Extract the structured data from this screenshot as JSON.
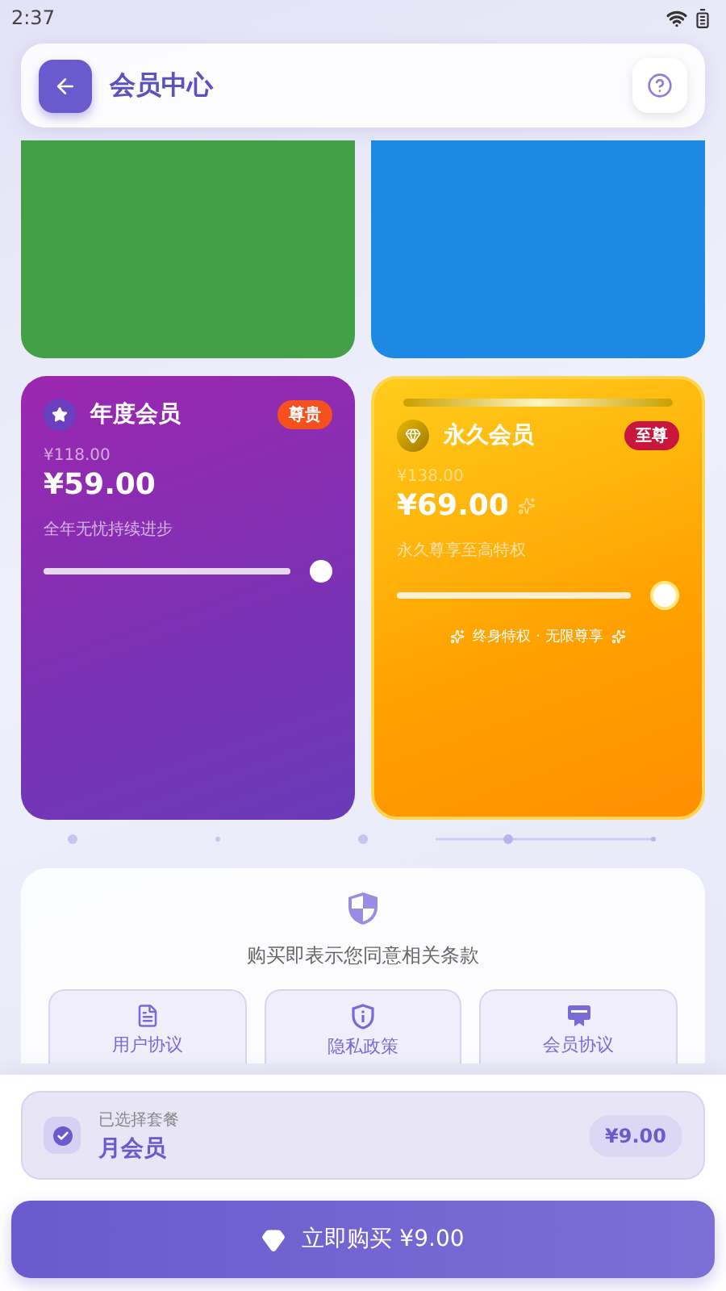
{
  "status_bar": {
    "time": "2:37"
  },
  "header": {
    "title": "会员中心"
  },
  "top_cards": [
    {
      "color": "#43a047"
    },
    {
      "color": "#1e88e5"
    }
  ],
  "plans": [
    {
      "kind": "annual",
      "name": "年度会员",
      "badge": "尊贵",
      "original_price": "¥118.00",
      "price": "¥59.00",
      "slogan": "全年无忧持续进步",
      "level": 1
    },
    {
      "kind": "lifetime",
      "name": "永久会员",
      "badge": "至尊",
      "original_price": "¥138.00",
      "price": "¥69.00",
      "slogan": "永久尊享至高特权",
      "level": 1,
      "perks": "终身特权 · 无限尊享"
    }
  ],
  "terms": {
    "notice": "购买即表示您同意相关条款",
    "links": [
      {
        "kind": "document",
        "label": "用户协议"
      },
      {
        "kind": "privacy",
        "label": "隐私政策"
      },
      {
        "kind": "membership",
        "label": "会员协议"
      }
    ]
  },
  "selection": {
    "caption": "已选择套餐",
    "plan": "月会员",
    "price": "¥9.00",
    "checked": true
  },
  "buy_button": {
    "label": "立即购买 ¥9.00"
  }
}
